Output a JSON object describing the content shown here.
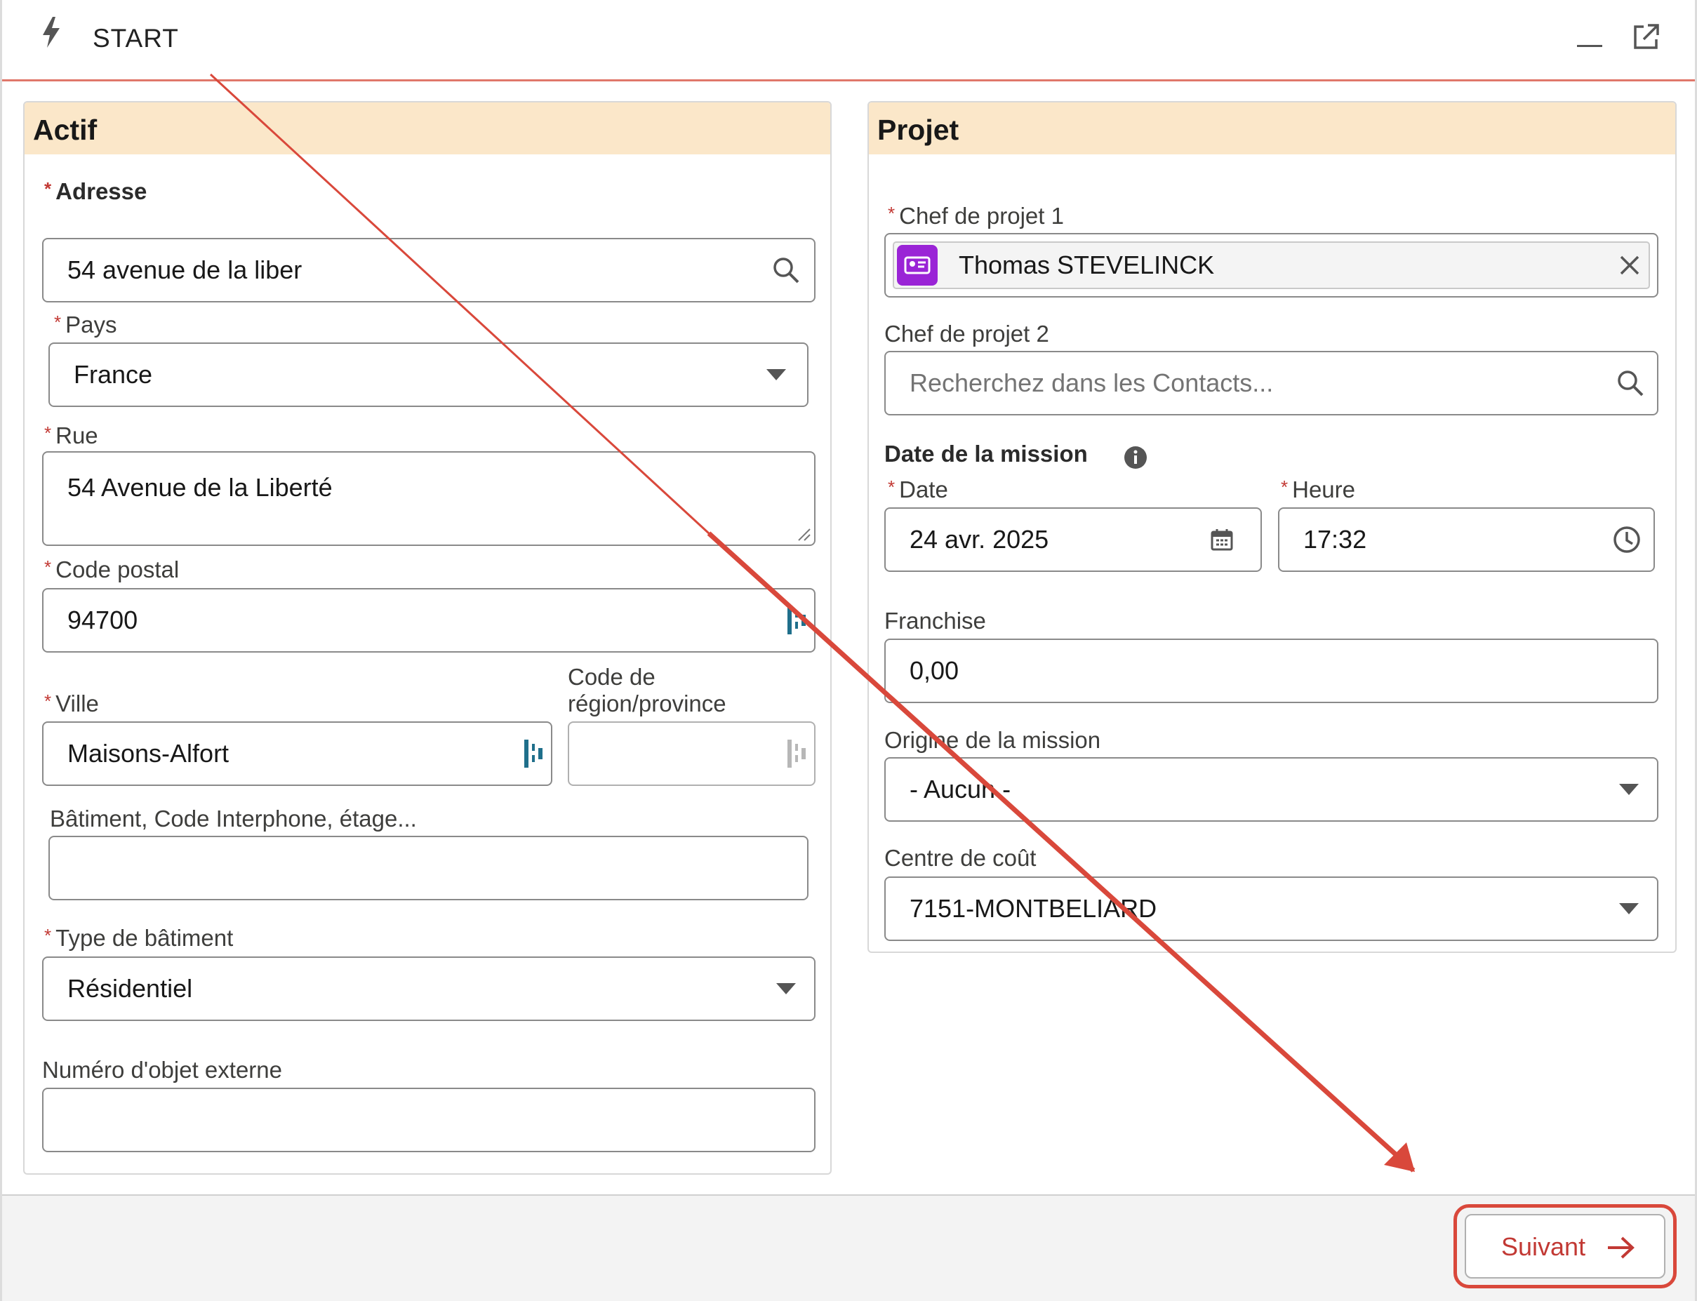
{
  "header": {
    "title": "START"
  },
  "actif": {
    "title": "Actif",
    "adresse": {
      "label": "Adresse",
      "value": "54 avenue de la liber"
    },
    "pays": {
      "label": "Pays",
      "value": "France"
    },
    "rue": {
      "label": "Rue",
      "value": "54 Avenue de la Liberté"
    },
    "code_postal": {
      "label": "Code postal",
      "value": "94700"
    },
    "ville": {
      "label": "Ville",
      "value": "Maisons-Alfort"
    },
    "region": {
      "label_line1": "Code de",
      "label_line2": "région/province",
      "value": ""
    },
    "batiment_info": {
      "label": "Bâtiment, Code Interphone, étage...",
      "value": ""
    },
    "type_batiment": {
      "label": "Type de bâtiment",
      "value": "Résidentiel"
    },
    "numero_objet": {
      "label": "Numéro d'objet externe",
      "value": ""
    }
  },
  "projet": {
    "title": "Projet",
    "chef1": {
      "label": "Chef de projet 1",
      "value": "Thomas STEVELINCK"
    },
    "chef2": {
      "label": "Chef de projet 2",
      "placeholder": "Recherchez dans les Contacts..."
    },
    "date_mission": {
      "label": "Date de la mission"
    },
    "date": {
      "label": "Date",
      "value": "24 avr. 2025"
    },
    "heure": {
      "label": "Heure",
      "value": "17:32"
    },
    "franchise": {
      "label": "Franchise",
      "value": "0,00"
    },
    "origine": {
      "label": "Origine de la mission",
      "value": "- Aucun -"
    },
    "centre_cout": {
      "label": "Centre de coût",
      "value": "7151-MONTBELIARD"
    }
  },
  "footer": {
    "next_label": "Suivant"
  },
  "colors": {
    "required": "#c23934",
    "panel_header": "#fbe7c9",
    "annotation": "#d9483b",
    "contact_icon": "#9a24d6"
  },
  "icons": [
    "bolt-icon",
    "minimize-icon",
    "popout-icon",
    "search-icon",
    "chevron-down-icon",
    "resize-grip-icon",
    "autofill-icon",
    "contact-icon",
    "clear-icon",
    "info-icon",
    "calendar-icon",
    "clock-icon",
    "arrow-right-icon"
  ]
}
